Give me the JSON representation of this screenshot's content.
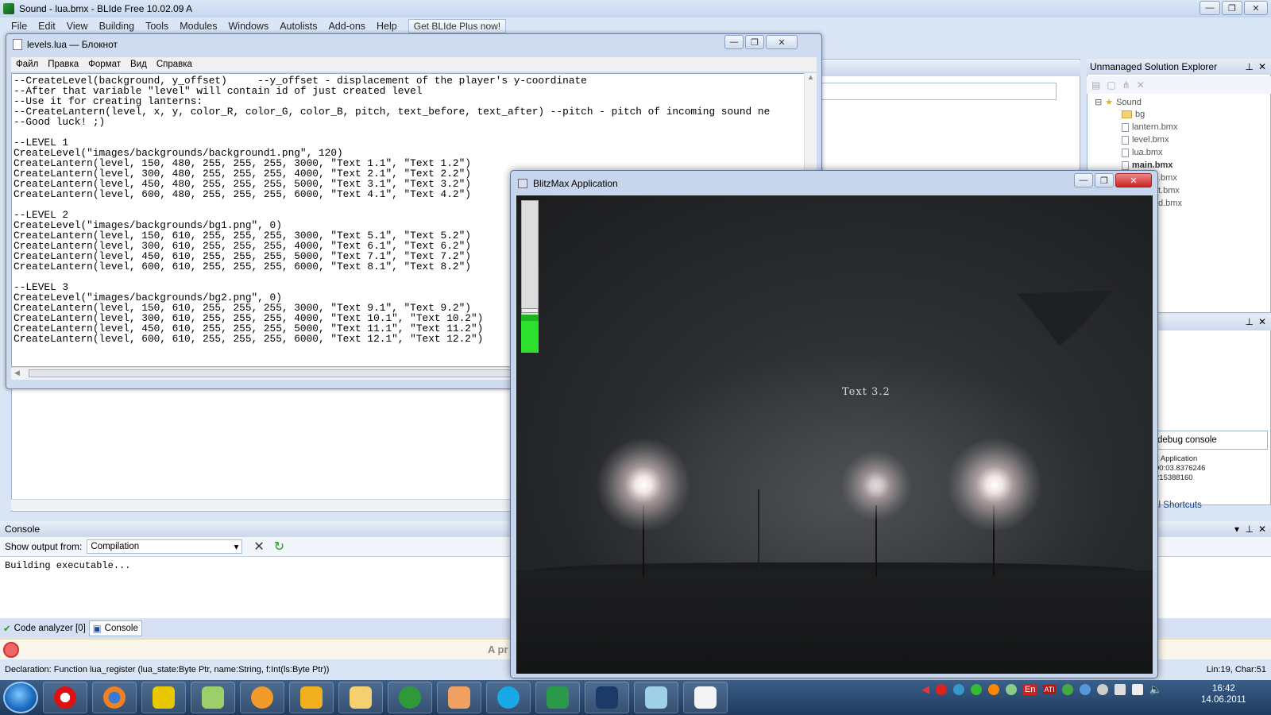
{
  "ide": {
    "title": "Sound - lua.bmx - BLIde Free 10.02.09 A",
    "menu": [
      "File",
      "Edit",
      "View",
      "Building",
      "Tools",
      "Modules",
      "Windows",
      "Autolists",
      "Add-ons",
      "Help"
    ],
    "get_plus": "Get BLIde Plus now!",
    "explorer": {
      "title": "Unmanaged Solution Explorer",
      "root": "Sound",
      "items": [
        "bg",
        "lantern.bmx",
        "level.bmx",
        "lua.bmx",
        "main.bmx",
        ".bmx",
        "t.bmx",
        "d.bmx"
      ]
    },
    "debug_console": "debug console",
    "debug_lines": [
      "x Application",
      "00:03.8376246",
      "215388160"
    ],
    "local_shortcuts": "ocal Shortcuts",
    "console": {
      "title": "Console",
      "show_output_label": "Show output from:",
      "output_source": "Compilation",
      "output_text": "Building executable..."
    },
    "tabs": [
      "Code analyzer [0]",
      "Console"
    ],
    "notice_text": "A pr",
    "status": {
      "declaration": "Declaration: Function lua_register (lua_state:Byte Ptr, name:String, f:Int(ls:Byte Ptr))",
      "position": "Lin:19, Char:51"
    }
  },
  "notepad": {
    "title": "levels.lua — Блокнот",
    "menu": [
      "Файл",
      "Правка",
      "Формат",
      "Вид",
      "Справка"
    ],
    "lines": [
      "--CreateLevel(background, y_offset)     --y_offset - displacement of the player's y-coordinate",
      "--After that variable \"level\" will contain id of just created level",
      "--Use it for creating lanterns:",
      "--CreateLantern(level, x, y, color_R, color_G, color_B, pitch, text_before, text_after) --pitch - pitch of incoming sound ne",
      "--Good luck! ;)",
      "",
      "--LEVEL 1",
      "CreateLevel(\"images/backgrounds/background1.png\", 120)",
      "CreateLantern(level, 150, 480, 255, 255, 255, 3000, \"Text 1.1\", \"Text 1.2\")",
      "CreateLantern(level, 300, 480, 255, 255, 255, 4000, \"Text 2.1\", \"Text 2.2\")",
      "CreateLantern(level, 450, 480, 255, 255, 255, 5000, \"Text 3.1\", \"Text 3.2\")",
      "CreateLantern(level, 600, 480, 255, 255, 255, 6000, \"Text 4.1\", \"Text 4.2\")",
      "",
      "--LEVEL 2",
      "CreateLevel(\"images/backgrounds/bg1.png\", 0)",
      "CreateLantern(level, 150, 610, 255, 255, 255, 3000, \"Text 5.1\", \"Text 5.2\")",
      "CreateLantern(level, 300, 610, 255, 255, 255, 4000, \"Text 6.1\", \"Text 6.2\")",
      "CreateLantern(level, 450, 610, 255, 255, 255, 5000, \"Text 7.1\", \"Text 7.2\")",
      "CreateLantern(level, 600, 610, 255, 255, 255, 6000, \"Text 8.1\", \"Text 8.2\")",
      "",
      "--LEVEL 3",
      "CreateLevel(\"images/backgrounds/bg2.png\", 0)",
      "CreateLantern(level, 150, 610, 255, 255, 255, 3000, \"Text 9.1\", \"Text 9.2\")",
      "CreateLantern(level, 300, 610, 255, 255, 255, 4000, \"Text 10.1\", \"Text 10.2\")",
      "CreateLantern(level, 450, 610, 255, 255, 255, 5000, \"Text 11.1\", \"Text 11.2\")",
      "CreateLantern(level, 600, 610, 255, 255, 255, 6000, \"Text 12.1\", \"Text 12.2\")"
    ]
  },
  "blitzmax": {
    "title": "BlitzMax Application",
    "game_text": "Text 3.2",
    "sound_meter_level": 0.25
  },
  "taskbar": {
    "lang": "En",
    "ati": "ATI",
    "clock_time": "16:42",
    "clock_date": "14.06.2011",
    "apps": [
      "Opera",
      "Firefox",
      "Batman",
      "Recycle",
      "Player",
      "Winamp",
      "Explorer",
      "uTorrent",
      "Anime",
      "Skype",
      "Cube",
      "Photoshop",
      "Notepad++",
      "Notepad"
    ]
  }
}
